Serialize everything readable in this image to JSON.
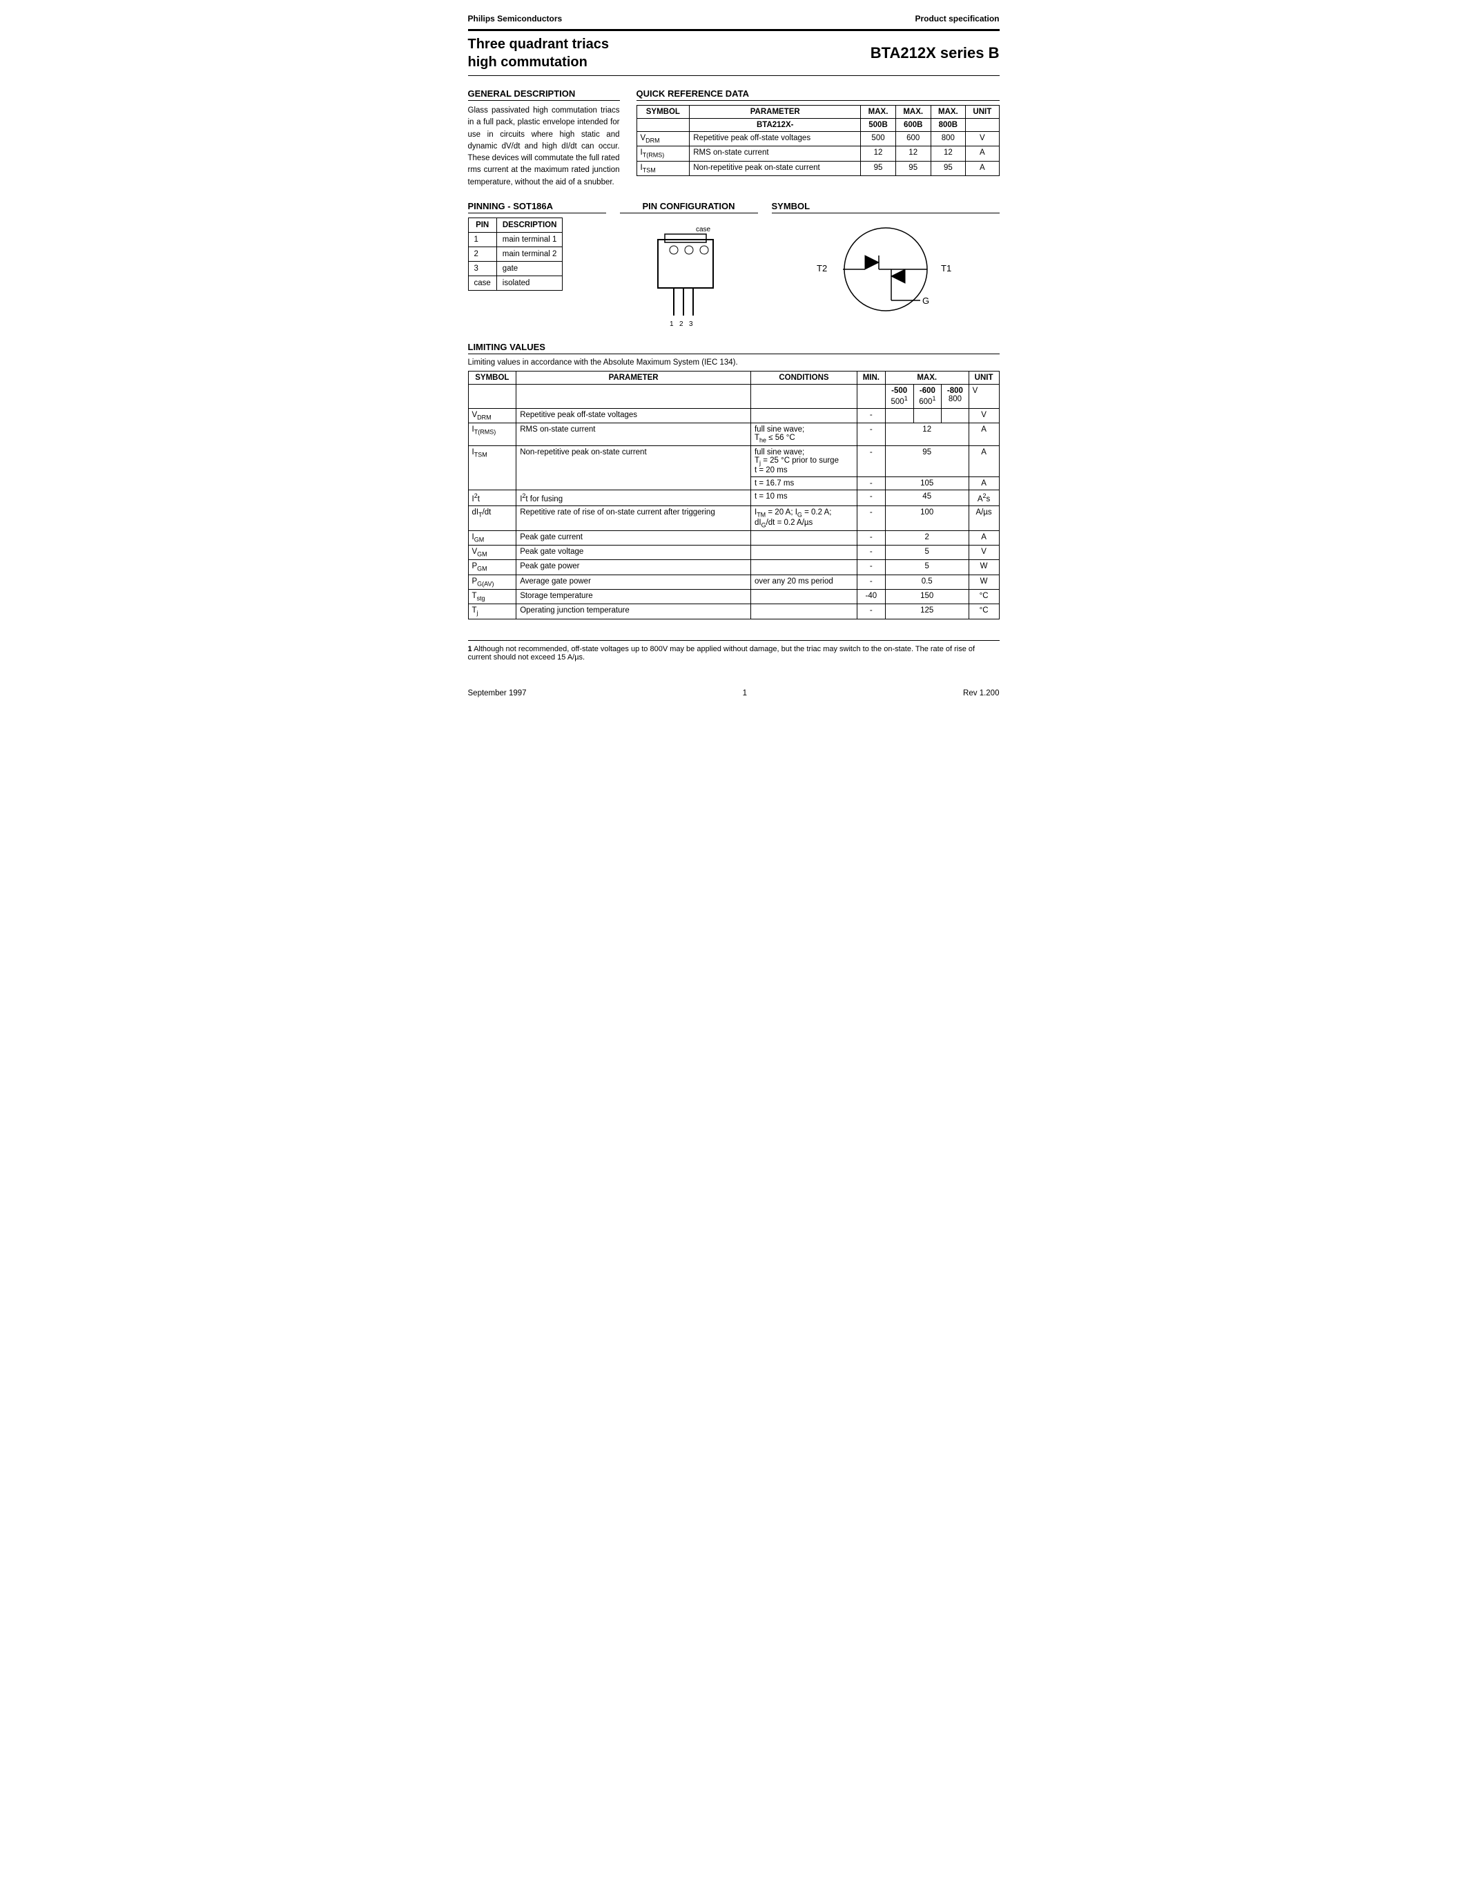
{
  "header": {
    "company": "Philips Semiconductors",
    "product_type": "Product specification",
    "title_left_line1": "Three quadrant triacs",
    "title_left_line2": "high commutation",
    "title_right": "BTA212X series B"
  },
  "general_description": {
    "section_title": "GENERAL DESCRIPTION",
    "text": "Glass passivated high commutation triacs in a full pack, plastic envelope intended for use in circuits where high static and dynamic dV/dt and high dI/dt can occur. These devices will commutate the full rated rms current at the maximum rated junction temperature, without the aid of a snubber."
  },
  "quick_reference": {
    "section_title": "QUICK REFERENCE DATA",
    "columns": [
      "SYMBOL",
      "PARAMETER",
      "MAX.",
      "MAX.",
      "MAX.",
      "UNIT"
    ],
    "subtitle_row": [
      "",
      "BTA212X-",
      "500B",
      "600B",
      "800B",
      ""
    ],
    "rows": [
      [
        "V_DRM",
        "Repetitive peak off-state voltages",
        "500",
        "600",
        "800",
        "V"
      ],
      [
        "I_T(RMS)",
        "RMS on-state current",
        "12",
        "12",
        "12",
        "A"
      ],
      [
        "I_TSM",
        "Non-repetitive peak on-state current",
        "95",
        "95",
        "95",
        "A"
      ]
    ]
  },
  "pinning": {
    "section_title": "PINNING - SOT186A",
    "col_pin": "PIN",
    "col_desc": "DESCRIPTION",
    "rows": [
      [
        "1",
        "main terminal 1"
      ],
      [
        "2",
        "main terminal 2"
      ],
      [
        "3",
        "gate"
      ],
      [
        "case",
        "isolated"
      ]
    ]
  },
  "pin_config": {
    "section_title": "PIN CONFIGURATION"
  },
  "symbol_section": {
    "section_title": "SYMBOL",
    "t2_label": "T2",
    "t1_label": "T1",
    "g_label": "G"
  },
  "limiting_values": {
    "section_title": "LIMITING VALUES",
    "intro": "Limiting values in accordance with the Absolute Maximum System (IEC 134).",
    "columns": [
      "SYMBOL",
      "PARAMETER",
      "CONDITIONS",
      "MIN.",
      "MAX.",
      "UNIT"
    ],
    "rows": [
      {
        "symbol": "V_DRM",
        "parameter": "Repetitive peak off-state voltages",
        "conditions": "",
        "min": "-",
        "max_cols": [
          "-500\n500¹",
          "-600\n600¹",
          "-800\n800"
        ],
        "unit": "V",
        "rowspan": 1,
        "max_merged": false
      },
      {
        "symbol": "I_T(RMS)",
        "parameter": "RMS on-state current",
        "conditions": "full sine wave;\nT_he ≤ 56 °C",
        "min": "-",
        "max": "12",
        "unit": "A",
        "max_merged": true
      },
      {
        "symbol": "I_TSM",
        "parameter": "Non-repetitive peak on-state current",
        "conditions": "full sine wave;\nT_j = 25 °C prior to surge",
        "min": "",
        "max": "",
        "unit": "",
        "max_merged": true,
        "sub_rows": [
          {
            "conditions": "t = 20 ms",
            "min": "-",
            "max": "95",
            "unit": "A"
          },
          {
            "conditions": "t = 16.7 ms",
            "min": "-",
            "max": "105",
            "unit": "A"
          }
        ]
      },
      {
        "symbol": "I²t",
        "parameter": "I²t for fusing",
        "conditions": "t = 10 ms",
        "min": "-",
        "max": "45",
        "unit": "A²s",
        "max_merged": true
      },
      {
        "symbol": "dI_T/dt",
        "parameter": "Repetitive rate of rise of on-state current after triggering",
        "conditions": "I_TM = 20 A; I_G = 0.2 A;\ndI_G/dt = 0.2 A/µs",
        "min": "-",
        "max": "100",
        "unit": "A/µs",
        "max_merged": true
      },
      {
        "symbol": "I_GM",
        "parameter": "Peak gate current",
        "conditions": "",
        "min": "-",
        "max": "2",
        "unit": "A",
        "max_merged": true
      },
      {
        "symbol": "V_GM",
        "parameter": "Peak gate voltage",
        "conditions": "",
        "min": "-",
        "max": "5",
        "unit": "V",
        "max_merged": true
      },
      {
        "symbol": "P_GM",
        "parameter": "Peak gate power",
        "conditions": "",
        "min": "-",
        "max": "5",
        "unit": "W",
        "max_merged": true
      },
      {
        "symbol": "P_G(AV)",
        "parameter": "Average gate power",
        "conditions": "over any 20 ms period",
        "min": "-",
        "max": "0.5",
        "unit": "W",
        "max_merged": true
      },
      {
        "symbol": "T_stg",
        "parameter": "Storage temperature",
        "conditions": "",
        "min": "-40",
        "max": "150",
        "unit": "°C",
        "max_merged": true
      },
      {
        "symbol": "T_j",
        "parameter": "Operating junction temperature",
        "conditions": "",
        "min": "-",
        "max": "125",
        "unit": "°C",
        "max_merged": true
      }
    ]
  },
  "footnote": {
    "number": "1",
    "text": "Although not recommended, off-state voltages up to 800V may be applied without damage, but the triac may switch to the on-state. The rate of rise of current should not exceed 15 A/µs."
  },
  "footer": {
    "date": "September 1997",
    "page": "1",
    "revision": "Rev 1.200"
  }
}
